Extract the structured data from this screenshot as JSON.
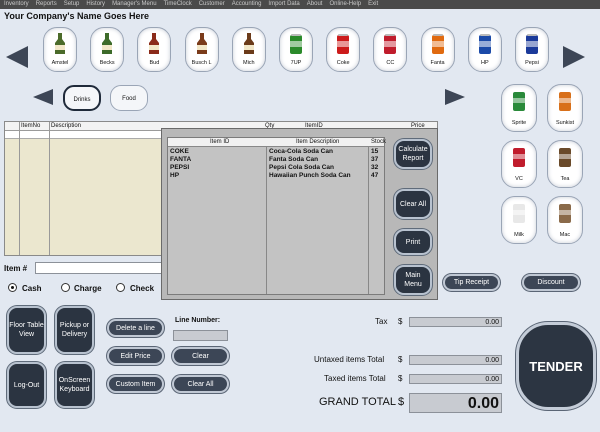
{
  "menu": [
    "Inventory",
    "Reports",
    "Setup",
    "History",
    "Manager's Menu",
    "TimeClock",
    "Customer",
    "Accounting",
    "Import Data",
    "About",
    "Online-Help",
    "Exit"
  ],
  "company_name": "Your Company's Name Goes Here",
  "products": [
    {
      "label": "Amstel",
      "color": "#4b6b2a"
    },
    {
      "label": "Becks",
      "color": "#3d6b2a"
    },
    {
      "label": "Bud",
      "color": "#8b2b1a"
    },
    {
      "label": "Busch L",
      "color": "#7a3b1a"
    },
    {
      "label": "Mich",
      "color": "#6b3b1a"
    },
    {
      "label": "7UP",
      "color": "#2a8a2a"
    },
    {
      "label": "Coke",
      "color": "#cc1b1b"
    },
    {
      "label": "CC",
      "color": "#c01c2c"
    },
    {
      "label": "Fanta",
      "color": "#e06a10"
    },
    {
      "label": "HP",
      "color": "#1b4aa8"
    },
    {
      "label": "Pepsi",
      "color": "#1b3a9a"
    }
  ],
  "categories": [
    {
      "label": "Drinks",
      "selected": true
    },
    {
      "label": "Food",
      "selected": false
    }
  ],
  "side_products": [
    {
      "label": "Sprite",
      "color": "#2a8a3a"
    },
    {
      "label": "Sunkist",
      "color": "#d8701a"
    },
    {
      "label": "VC",
      "color": "#c01c2c"
    },
    {
      "label": "Tea",
      "color": "#6a4a2a"
    },
    {
      "label": "Milk",
      "color": "#e8e8e8"
    },
    {
      "label": "Mac",
      "color": "#8a6a4a"
    }
  ],
  "grid": {
    "headers": {
      "item_no": "ItemNo",
      "description": "Description",
      "qty": "Qty",
      "item_id": "ItemID",
      "price": "Price"
    }
  },
  "popup": {
    "headers": {
      "item_id": "Item ID",
      "item_description": "Item Description",
      "stock": "Stock"
    },
    "rows": [
      {
        "item_id": "COKE",
        "item_description": "Coca-Cola Soda Can",
        "stock": "15"
      },
      {
        "item_id": "FANTA",
        "item_description": "Fanta Soda Can",
        "stock": "37"
      },
      {
        "item_id": "PEPSI",
        "item_description": "Pepsi Cola Soda Can",
        "stock": "32"
      },
      {
        "item_id": "HP",
        "item_description": "Hawaiian Punch Soda Can",
        "stock": "47"
      }
    ],
    "buttons": {
      "calculate": "Calculate Report",
      "clear_all": "Clear All",
      "print": "Print",
      "main_menu": "Main Menu"
    }
  },
  "item_label": "Item #",
  "payment": {
    "cash": "Cash",
    "charge": "Charge",
    "check": "Check",
    "selected": "cash"
  },
  "buttons": {
    "tip_receipt": "Tip Receipt",
    "discount": "Discount",
    "floor_table_view": "Floor Table View",
    "pickup_delivery": "Pickup or Delivery",
    "log_out": "Log-Out",
    "onscreen_keyboard": "OnScreen Keyboard",
    "delete_line": "Delete a line",
    "edit_price": "Edit Price",
    "custom_item": "Custom Item",
    "clear": "Clear",
    "clear_all": "Clear All",
    "tender": "TENDER"
  },
  "line_number_label": "Line Number:",
  "totals": {
    "tax_label": "Tax",
    "tax_value": "0.00",
    "untaxed_label": "Untaxed items Total",
    "untaxed_value": "0.00",
    "taxed_label": "Taxed items Total",
    "taxed_value": "0.00",
    "grand_label": "GRAND TOTAL",
    "grand_value": "0.00",
    "currency": "$"
  }
}
